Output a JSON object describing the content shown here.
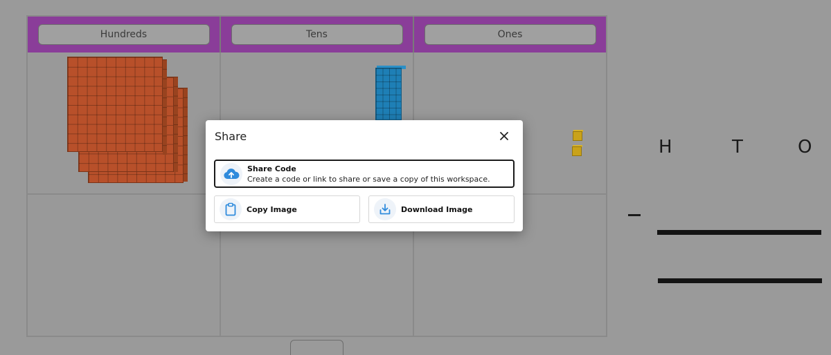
{
  "board": {
    "columns": [
      {
        "label": "Hundreds"
      },
      {
        "label": "Tens"
      },
      {
        "label": "Ones"
      }
    ],
    "blocks": {
      "hundreds": 3,
      "tens": 1,
      "ones": 2
    }
  },
  "side": {
    "letters": [
      "H",
      "T",
      "O"
    ],
    "operator": "–"
  },
  "modal": {
    "title": "Share",
    "close_icon": "close-icon",
    "share_code": {
      "icon": "cloud-upload-icon",
      "title": "Share Code",
      "description": "Create a code or link to share or save a copy of this workspace."
    },
    "copy_image": {
      "icon": "clipboard-icon",
      "label": "Copy Image"
    },
    "download_image": {
      "icon": "download-icon",
      "label": "Download Image"
    }
  },
  "colors": {
    "header_purple": "#8a3d99",
    "hundreds_orange": "#b8502a",
    "tens_blue": "#1e7fb6",
    "ones_yellow": "#c9a21a",
    "icon_blue": "#2f8bdc"
  }
}
